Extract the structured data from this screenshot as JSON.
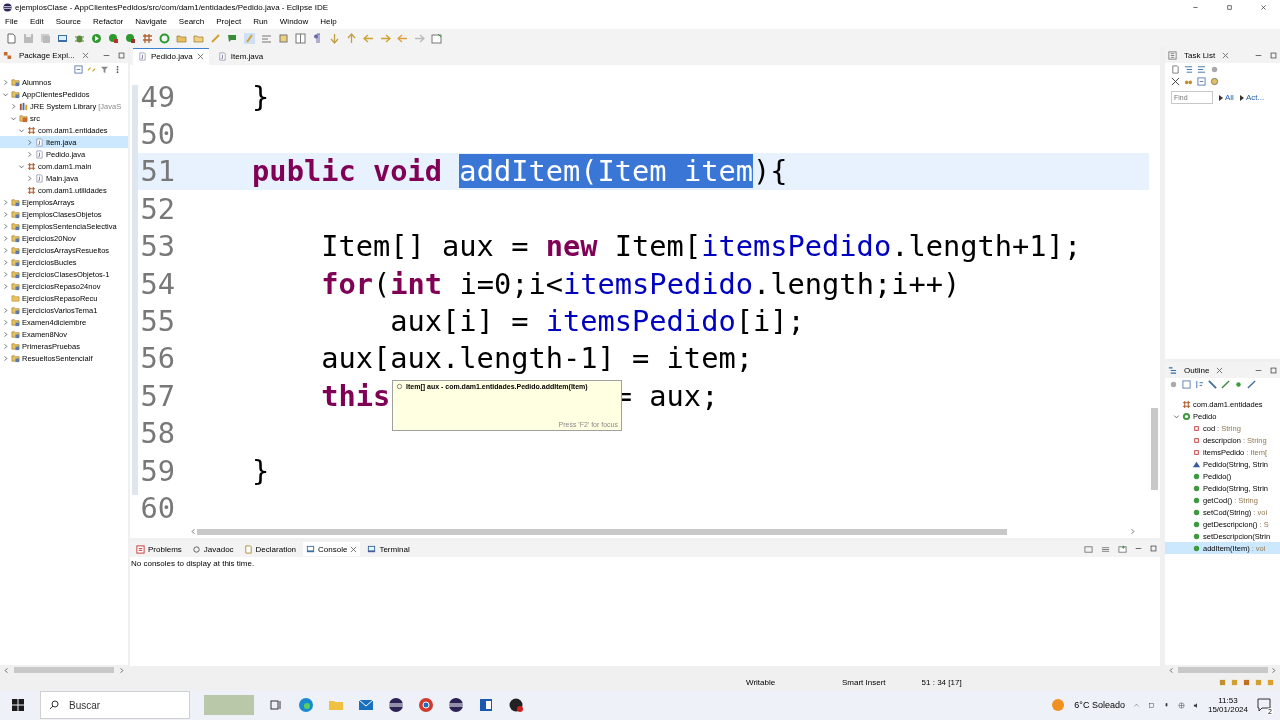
{
  "window": {
    "title": "ejemplosClase - AppClientesPedidos/src/com/dam1/entidades/Pedido.java - Eclipse IDE"
  },
  "menu": [
    "File",
    "Edit",
    "Source",
    "Refactor",
    "Navigate",
    "Search",
    "Project",
    "Run",
    "Window",
    "Help"
  ],
  "package_explorer": {
    "title": "Package Expl...",
    "tree": [
      {
        "label": "Alumnos",
        "kind": "project",
        "expanded": false,
        "selected": false
      },
      {
        "label": "AppClientesPedidos",
        "kind": "project",
        "expanded": true,
        "selected": false,
        "children": [
          {
            "label": "JRE System Library",
            "decoration": "[JavaS",
            "kind": "library",
            "expanded": false,
            "selected": false
          },
          {
            "label": "src",
            "kind": "source",
            "expanded": true,
            "selected": false,
            "children": [
              {
                "label": "com.dam1.entidades",
                "kind": "package",
                "expanded": true,
                "selected": false,
                "children": [
                  {
                    "label": "Item.java",
                    "kind": "file",
                    "expanded": false,
                    "selected": true
                  },
                  {
                    "label": "Pedido.java",
                    "kind": "file",
                    "expanded": false,
                    "selected": false
                  }
                ]
              },
              {
                "label": "com.dam1.main",
                "kind": "package",
                "expanded": true,
                "selected": false,
                "children": [
                  {
                    "label": "Main.java",
                    "kind": "file",
                    "expanded": false,
                    "selected": false
                  }
                ]
              },
              {
                "label": "com.dam1.utilidades",
                "kind": "package",
                "selected": false
              }
            ]
          }
        ]
      },
      {
        "label": "EjemplosArrays",
        "kind": "project",
        "expanded": false,
        "selected": false
      },
      {
        "label": "EjemplosClasesObjetos",
        "kind": "project",
        "expanded": false,
        "selected": false
      },
      {
        "label": "EjemplosSentenciaSelectiva",
        "kind": "project",
        "expanded": false,
        "selected": false
      },
      {
        "label": "Ejercicios20Nov",
        "kind": "project",
        "expanded": false,
        "selected": false
      },
      {
        "label": "EjerciciosArraysResueltos",
        "kind": "project",
        "expanded": false,
        "selected": false
      },
      {
        "label": "EjerciciosBucles",
        "kind": "project",
        "expanded": false,
        "selected": false
      },
      {
        "label": "EjerciciosClasesObjetos-1",
        "kind": "project",
        "expanded": false,
        "selected": false
      },
      {
        "label": "EjerciciosRepaso24nov",
        "kind": "project",
        "expanded": false,
        "selected": false
      },
      {
        "label": "EjerciciosRepasoRecu",
        "kind": "folder",
        "selected": false
      },
      {
        "label": "EjerciciosVariosTema1",
        "kind": "project",
        "expanded": false,
        "selected": false
      },
      {
        "label": "Examen4diciembre",
        "kind": "project",
        "expanded": false,
        "selected": false
      },
      {
        "label": "Examen8Nov",
        "kind": "project",
        "expanded": false,
        "selected": false
      },
      {
        "label": "PrimerasPruebas",
        "kind": "project",
        "expanded": false,
        "selected": false
      },
      {
        "label": "ResueltosSentencialf",
        "kind": "project",
        "expanded": false,
        "selected": false
      }
    ]
  },
  "editor_tabs": [
    {
      "label": "Pedido.java",
      "selected": true
    },
    {
      "label": "Item.java",
      "selected": false
    }
  ],
  "code": [
    {
      "number": "49",
      "current": false,
      "tokens": [
        {
          "text": "    }",
          "kind": "plain"
        }
      ]
    },
    {
      "number": "50",
      "current": false
    },
    {
      "number": "51",
      "current": true,
      "tokens": [
        {
          "text": "    public ",
          "kind": "keyword"
        },
        {
          "text": "void ",
          "kind": "keyword"
        },
        {
          "text": "addItem(Item item",
          "kind": "selection"
        },
        {
          "text": "){",
          "kind": "plain"
        }
      ]
    },
    {
      "number": "52",
      "current": false
    },
    {
      "number": "53",
      "current": false,
      "tokens": [
        {
          "text": "        Item[] aux = ",
          "kind": "plain"
        },
        {
          "text": "new",
          "kind": "keyword"
        },
        {
          "text": " Item[",
          "kind": "plain"
        },
        {
          "text": "itemsPedido",
          "kind": "field"
        },
        {
          "text": ".length+1];",
          "kind": "plain"
        }
      ]
    },
    {
      "number": "54",
      "current": false,
      "tokens": [
        {
          "text": "        for",
          "kind": "keyword"
        },
        {
          "text": "(",
          "kind": "plain"
        },
        {
          "text": "int",
          "kind": "keyword"
        },
        {
          "text": " i=0;i<",
          "kind": "plain"
        },
        {
          "text": "itemsPedido",
          "kind": "field"
        },
        {
          "text": ".length;i++)",
          "kind": "plain"
        }
      ]
    },
    {
      "number": "55",
      "current": false,
      "tokens": [
        {
          "text": "            aux[i] = ",
          "kind": "plain"
        },
        {
          "text": "itemsPedido",
          "kind": "field"
        },
        {
          "text": "[i];",
          "kind": "plain"
        }
      ]
    },
    {
      "number": "56",
      "current": false,
      "tokens": [
        {
          "text": "        aux[aux.length-1] = item;",
          "kind": "plain"
        }
      ]
    },
    {
      "number": "57",
      "current": false,
      "tokens": [
        {
          "text": "        this",
          "kind": "keyword"
        },
        {
          "text": "= aux;",
          "kind": "plain",
          "covered_before": true
        }
      ]
    },
    {
      "number": "58",
      "current": false
    },
    {
      "number": "59",
      "current": false,
      "tokens": [
        {
          "text": "    }",
          "kind": "plain"
        }
      ]
    },
    {
      "number": "60",
      "current": false
    }
  ],
  "tooltip": {
    "text": "Item[] aux - com.dam1.entidades.Pedido.addItem(Item)",
    "hint": "Press 'F2' for focus"
  },
  "bottom_tabs": [
    {
      "label": "Problems",
      "selected": false
    },
    {
      "label": "Javadoc",
      "selected": false
    },
    {
      "label": "Declaration",
      "selected": false
    },
    {
      "label": "Console",
      "selected": true
    },
    {
      "label": "Terminal",
      "selected": false
    }
  ],
  "console_message": "No consoles to display at this time.",
  "task_list": {
    "title": "Task List",
    "find": {
      "placeholder": "Find"
    },
    "filters": [
      "All",
      "Act..."
    ]
  },
  "outline": {
    "title": "Outline",
    "items": [
      {
        "label": "com.dam1.entidades",
        "kind": "package",
        "selected": false
      },
      {
        "label": "Pedido",
        "kind": "class",
        "expanded": true,
        "selected": false,
        "children": [
          {
            "label": "cod",
            "type": " : String",
            "kind": "field",
            "selected": false
          },
          {
            "label": "descripcion",
            "type": " : String",
            "kind": "field",
            "selected": false
          },
          {
            "label": "itemsPedido",
            "type": " : Item[",
            "kind": "field",
            "selected": false
          },
          {
            "label": "Pedido(String, Strin",
            "kind": "constructor-protected",
            "selected": false
          },
          {
            "label": "Pedido()",
            "kind": "constructor",
            "selected": false
          },
          {
            "label": "Pedido(String, Strin",
            "kind": "constructor",
            "selected": false
          },
          {
            "label": "getCod()",
            "type": " : String",
            "kind": "method",
            "selected": false
          },
          {
            "label": "setCod(String)",
            "type": " : voi",
            "kind": "method",
            "selected": false
          },
          {
            "label": "getDescripcion()",
            "type": " : S",
            "kind": "method",
            "selected": false
          },
          {
            "label": "setDescripcion(Strin",
            "kind": "method",
            "selected": false
          },
          {
            "label": "addItem(Item)",
            "type": " : voi",
            "kind": "method",
            "selected": true
          }
        ]
      }
    ]
  },
  "status_bar": [
    "Writable",
    "Smart Insert",
    "51 : 34 [17]"
  ],
  "taskbar": {
    "search": {
      "placeholder": "Buscar"
    },
    "weather": "6°C  Soleado",
    "time": "11:53",
    "date": "15/01/2024",
    "notifications": "2"
  }
}
